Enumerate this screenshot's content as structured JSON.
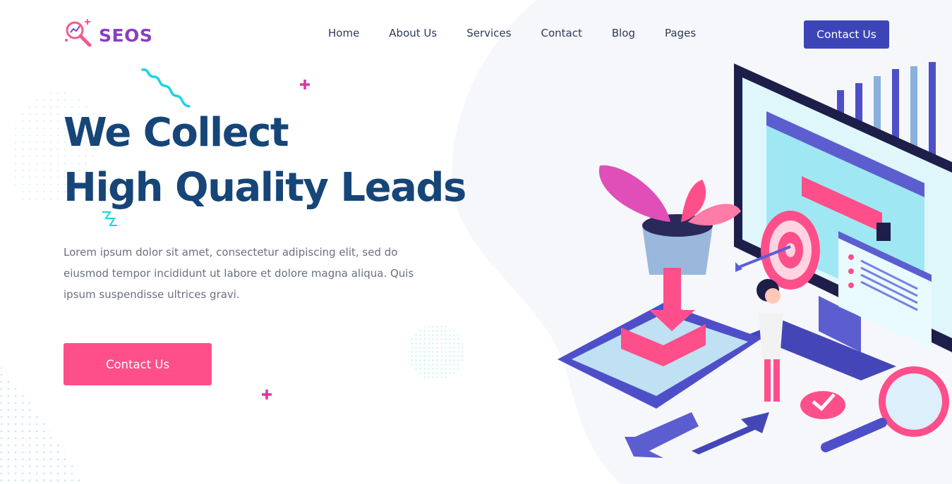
{
  "brand": {
    "name": "SEOS",
    "icon": "magnifier-chart-icon"
  },
  "nav": {
    "items": [
      {
        "label": "Home"
      },
      {
        "label": "About Us"
      },
      {
        "label": "Services"
      },
      {
        "label": "Contact"
      },
      {
        "label": "Blog"
      },
      {
        "label": "Pages"
      }
    ],
    "cta_label": "Contact Us"
  },
  "hero": {
    "title_line1": "We Collect",
    "title_line2": "High Quality Leads",
    "description": "Lorem ipsum dolor sit amet, consectetur adipiscing elit, sed do eiusmod tempor incididunt ut labore et dolore magna aliqua. Quis ipsum suspendisse ultrices gravi.",
    "cta_label": "Contact Us"
  },
  "colors": {
    "brand_purple": "#8a3fbf",
    "title_navy": "#164578",
    "header_button": "#3c45b8",
    "hero_button": "#ff4f8b",
    "accent_cyan": "#19d3e6",
    "accent_pink": "#d9389e"
  },
  "illustration": {
    "icons": [
      "monitor-icon",
      "target-icon",
      "plant-icon",
      "tablet-icon",
      "magnifier-icon",
      "arrows-icon",
      "person-icon",
      "bar-chart-icon"
    ]
  }
}
